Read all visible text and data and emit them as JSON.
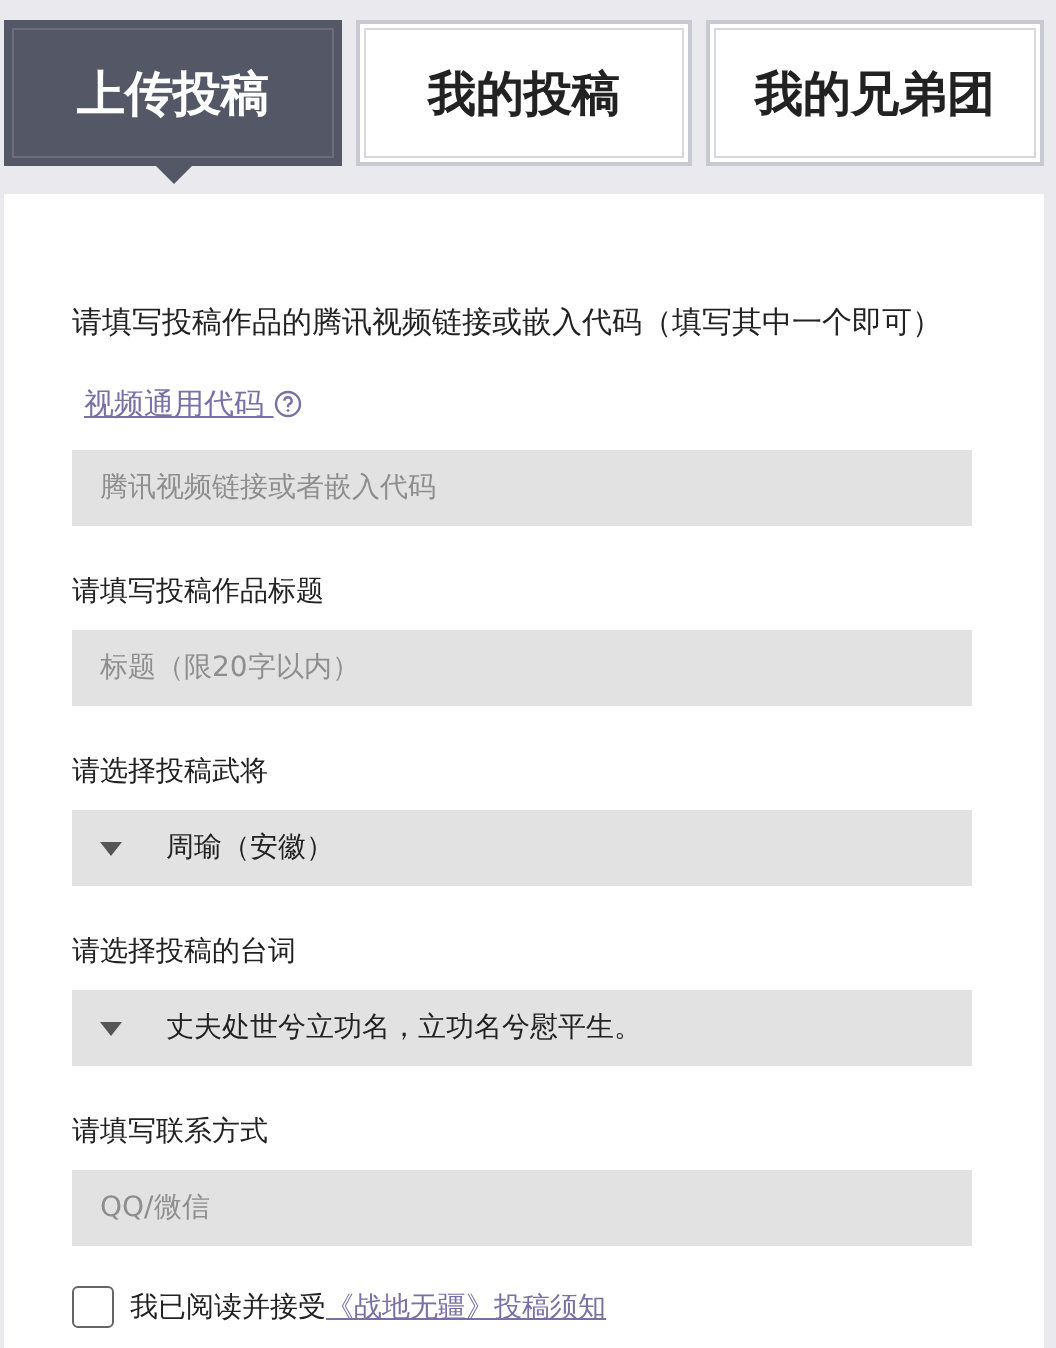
{
  "tabs": [
    {
      "label": "上传投稿",
      "selected": true
    },
    {
      "label": "我的投稿",
      "selected": false
    },
    {
      "label": "我的兄弟团",
      "selected": false
    }
  ],
  "intro": {
    "text": "请填写投稿作品的腾讯视频链接或嵌入代码（填写其中一个即可）",
    "link": "视频通用代码"
  },
  "fields": [
    {
      "kind": "text",
      "placeholder": "腾讯视频链接或者嵌入代码"
    },
    {
      "kind": "text",
      "label": "请填写投稿作品标题",
      "placeholder": "标题（限20字以内）"
    },
    {
      "kind": "select",
      "label": "请选择投稿武将",
      "value": "周瑜（安徽）"
    },
    {
      "kind": "select",
      "label": "请选择投稿的台词",
      "value": "丈夫处世兮立功名，立功名兮慰平生。"
    },
    {
      "kind": "text",
      "label": "请填写联系方式",
      "placeholder": "QQ/微信"
    }
  ],
  "agreement": {
    "checked": false,
    "text": "我已阅读并接受",
    "link": "《战地无疆》投稿须知"
  }
}
